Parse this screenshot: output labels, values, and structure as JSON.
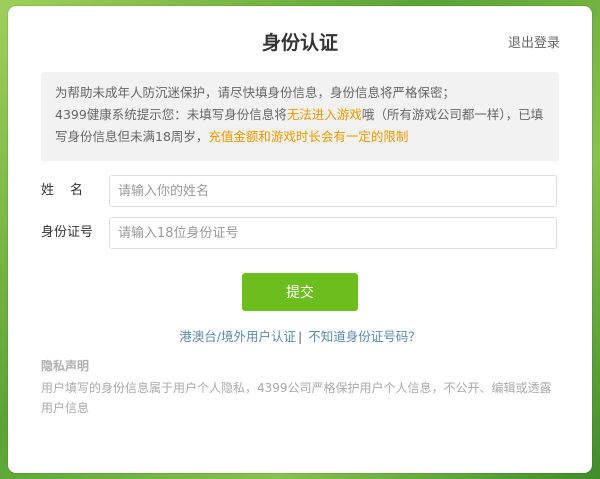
{
  "dialog": {
    "title": "身份认证",
    "logout_label": "退出登录"
  },
  "notice": {
    "line1": "为帮助未成年人防沉迷保护，请尽快填身份信息，身份信息将严格保密；",
    "line2_prefix": "4399健康系统提示您：未填写身份信息将",
    "line2_highlight": "无法进入游戏",
    "line2_suffix": "哦（所有游戏公司都一样），已填写身份信息但未满18周岁，",
    "line3_highlight": "充值金额和游戏时长会有一定的限制",
    "highlight_color": "#f39800"
  },
  "form": {
    "name_label": "姓名",
    "name_placeholder": "请输入你的姓名",
    "id_label": "身份证号",
    "id_placeholder": "请输入18位身份证号",
    "submit_label": "提交"
  },
  "links": {
    "hk_label": "港澳台/境外用户认证",
    "separator": "|",
    "unknown_id_label": "不知道身份证号码？"
  },
  "privacy": {
    "heading": "隐私声明",
    "text": "用户填写的身份信息属于用户个人隐私，4399公司严格保护用户个人信息，不公开、编辑或透露用户信息"
  },
  "colors": {
    "accent_green": "#6cbe1f",
    "link_blue": "#5a8aa8"
  }
}
